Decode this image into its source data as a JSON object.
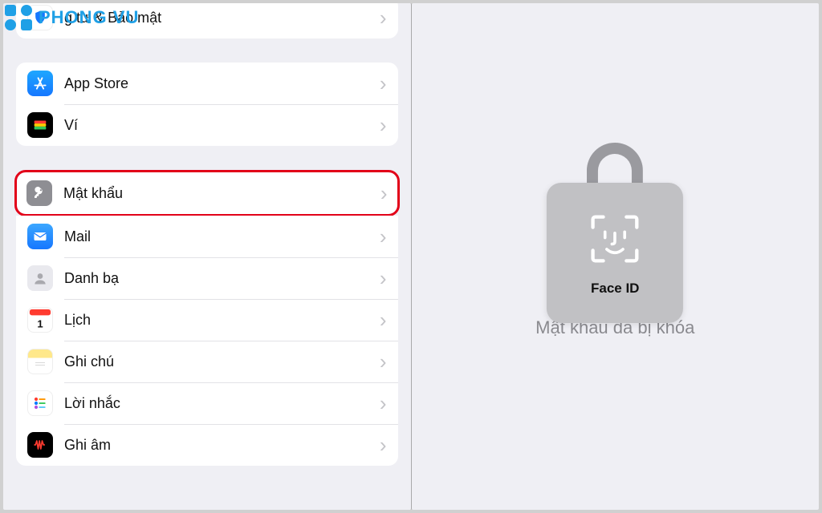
{
  "watermark": {
    "text": "PHONG VU"
  },
  "left": {
    "group1": {
      "privacy": {
        "label": "g tư & Bảo mật"
      }
    },
    "group2": {
      "appstore": {
        "label": "App Store"
      },
      "wallet": {
        "label": "Ví"
      }
    },
    "group3": {
      "passwords": {
        "label": "Mật khẩu"
      },
      "mail": {
        "label": "Mail"
      },
      "contacts": {
        "label": "Danh bạ"
      },
      "calendar": {
        "label": "Lịch"
      },
      "notes": {
        "label": "Ghi chú"
      },
      "reminders": {
        "label": "Lời nhắc"
      },
      "voicememos": {
        "label": "Ghi âm"
      }
    }
  },
  "right": {
    "faceid_label": "Face ID",
    "locked_text": "Mật khẩu đã bị khóa"
  }
}
